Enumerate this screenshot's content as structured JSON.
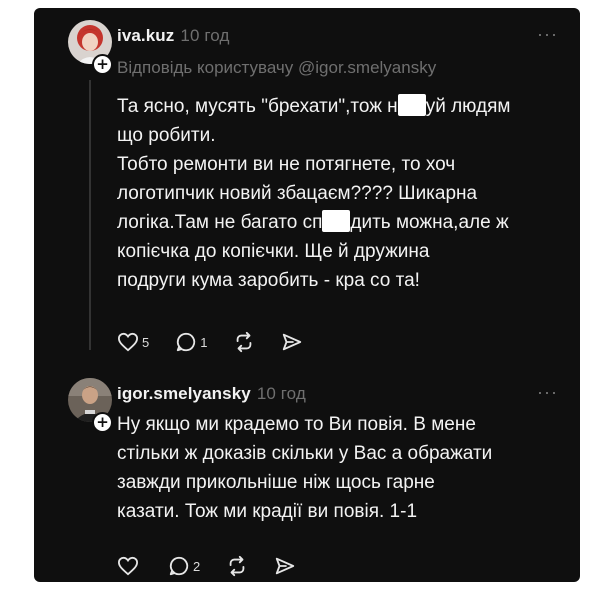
{
  "posts": [
    {
      "username": "iva.kuz",
      "timestamp": "10 год",
      "reply_to": "Відповідь користувачу @igor.smelyansky",
      "lines": [
        {
          "before": "Та ясно, мусять \"брехати\",тож н",
          "after": "уй людям"
        },
        {
          "before": "що робити.",
          "after": ""
        },
        {
          "before": "Тобто ремонти ви не потягнете, то хоч",
          "after": ""
        },
        {
          "before": "логотипчик новий збацаєм???? Шикарна",
          "after": ""
        },
        {
          "before": "логіка.Там не багато сп",
          "after": "дить можна,але ж"
        },
        {
          "before": "копієчка до копієчки. Ще й дружина",
          "after": ""
        },
        {
          "before": "подруги кума заробить - кра со та!",
          "after": ""
        }
      ],
      "actions": {
        "like_icon": "heart-icon",
        "like_count": "5",
        "reply_icon": "comment-icon",
        "reply_count": "1",
        "repost_icon": "repost-icon",
        "share_icon": "send-icon"
      }
    },
    {
      "username": "igor.smelyansky",
      "timestamp": "10 год",
      "lines": [
        "Ну якщо ми крадемо то Ви повія. В мене",
        "стільки ж доказів скільки у Вас а ображати",
        "завжди прикольніше ніж щось гарне",
        "казати. Тож ми крадії ви повія. 1-1"
      ],
      "actions": {
        "like_icon": "heart-icon",
        "like_count": "",
        "reply_icon": "comment-icon",
        "reply_count": "2",
        "repost_icon": "repost-icon",
        "share_icon": "send-icon"
      }
    }
  ],
  "more_icon": "ellipsis-icon",
  "more_glyph": "···",
  "plus_glyph": "+"
}
